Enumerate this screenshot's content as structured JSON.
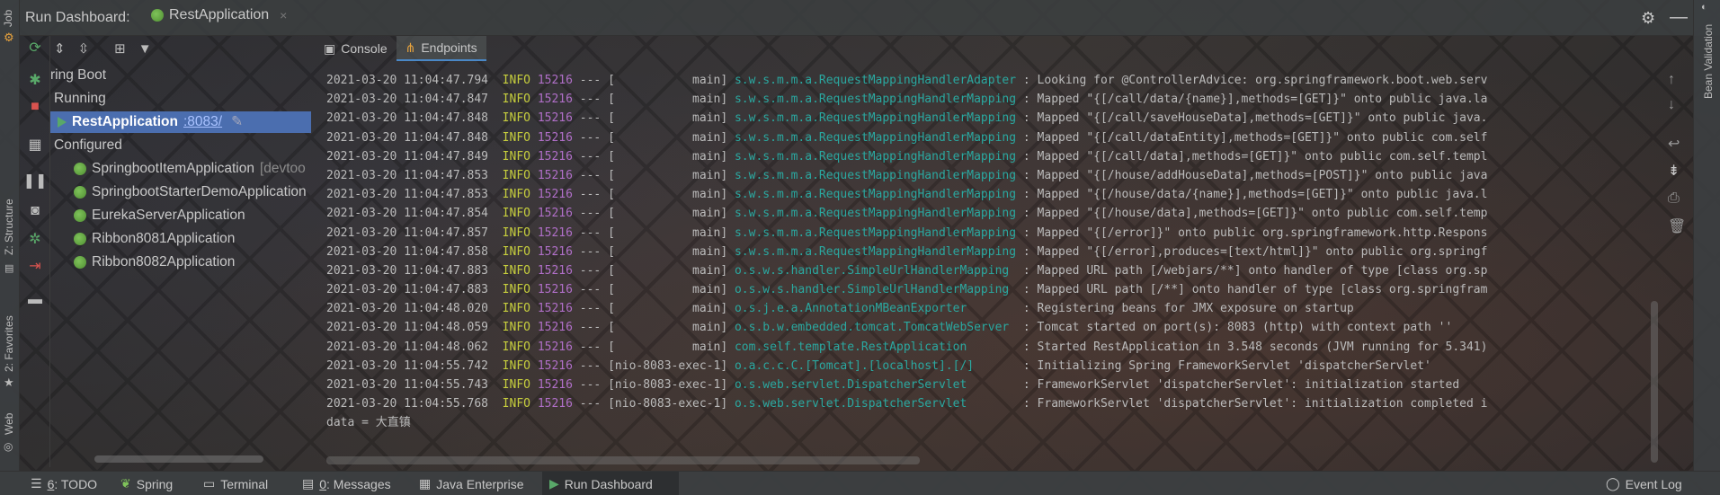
{
  "header": {
    "title": "Run Dashboard:",
    "app_tab": "RestApplication",
    "close": "×"
  },
  "left_strip": {
    "job": "Job",
    "structure": "Z: Structure",
    "favorites": "2: Favorites",
    "web": "Web"
  },
  "tree": {
    "root": "ring Boot",
    "running": "Running",
    "rest_app": "RestApplication",
    "rest_port": ":8083/",
    "configured": "Configured",
    "items": [
      {
        "name": "SpringbootItemApplication",
        "suffix": " [devtoo"
      },
      {
        "name": "SpringbootStarterDemoApplication",
        "suffix": ""
      },
      {
        "name": "EurekaServerApplication",
        "suffix": ""
      },
      {
        "name": "Ribbon8081Application",
        "suffix": ""
      },
      {
        "name": "Ribbon8082Application",
        "suffix": ""
      }
    ]
  },
  "console_tabs": {
    "console": "Console",
    "endpoints": "Endpoints"
  },
  "log": {
    "lines": [
      {
        "ts": "2021-03-20 11:04:47.794",
        "lvl": "INFO",
        "pid": "15216",
        "sep": " --- [",
        "thr": "           main]",
        "logger": "s.w.s.m.m.a.RequestMappingHandlerAdapter",
        "msg": " : Looking for @ControllerAdvice: org.springframework.boot.web.serv"
      },
      {
        "ts": "2021-03-20 11:04:47.847",
        "lvl": "INFO",
        "pid": "15216",
        "sep": " --- [",
        "thr": "           main]",
        "logger": "s.w.s.m.m.a.RequestMappingHandlerMapping",
        "msg": " : Mapped \"{[/call/data/{name}],methods=[GET]}\" onto public java.la"
      },
      {
        "ts": "2021-03-20 11:04:47.848",
        "lvl": "INFO",
        "pid": "15216",
        "sep": " --- [",
        "thr": "           main]",
        "logger": "s.w.s.m.m.a.RequestMappingHandlerMapping",
        "msg": " : Mapped \"{[/call/saveHouseData],methods=[GET]}\" onto public java."
      },
      {
        "ts": "2021-03-20 11:04:47.848",
        "lvl": "INFO",
        "pid": "15216",
        "sep": " --- [",
        "thr": "           main]",
        "logger": "s.w.s.m.m.a.RequestMappingHandlerMapping",
        "msg": " : Mapped \"{[/call/dataEntity],methods=[GET]}\" onto public com.self"
      },
      {
        "ts": "2021-03-20 11:04:47.849",
        "lvl": "INFO",
        "pid": "15216",
        "sep": " --- [",
        "thr": "           main]",
        "logger": "s.w.s.m.m.a.RequestMappingHandlerMapping",
        "msg": " : Mapped \"{[/call/data],methods=[GET]}\" onto public com.self.templ"
      },
      {
        "ts": "2021-03-20 11:04:47.853",
        "lvl": "INFO",
        "pid": "15216",
        "sep": " --- [",
        "thr": "           main]",
        "logger": "s.w.s.m.m.a.RequestMappingHandlerMapping",
        "msg": " : Mapped \"{[/house/addHouseData],methods=[POST]}\" onto public java"
      },
      {
        "ts": "2021-03-20 11:04:47.853",
        "lvl": "INFO",
        "pid": "15216",
        "sep": " --- [",
        "thr": "           main]",
        "logger": "s.w.s.m.m.a.RequestMappingHandlerMapping",
        "msg": " : Mapped \"{[/house/data/{name}],methods=[GET]}\" onto public java.l"
      },
      {
        "ts": "2021-03-20 11:04:47.854",
        "lvl": "INFO",
        "pid": "15216",
        "sep": " --- [",
        "thr": "           main]",
        "logger": "s.w.s.m.m.a.RequestMappingHandlerMapping",
        "msg": " : Mapped \"{[/house/data],methods=[GET]}\" onto public com.self.temp"
      },
      {
        "ts": "2021-03-20 11:04:47.857",
        "lvl": "INFO",
        "pid": "15216",
        "sep": " --- [",
        "thr": "           main]",
        "logger": "s.w.s.m.m.a.RequestMappingHandlerMapping",
        "msg": " : Mapped \"{[/error]}\" onto public org.springframework.http.Respons"
      },
      {
        "ts": "2021-03-20 11:04:47.858",
        "lvl": "INFO",
        "pid": "15216",
        "sep": " --- [",
        "thr": "           main]",
        "logger": "s.w.s.m.m.a.RequestMappingHandlerMapping",
        "msg": " : Mapped \"{[/error],produces=[text/html]}\" onto public org.springf"
      },
      {
        "ts": "2021-03-20 11:04:47.883",
        "lvl": "INFO",
        "pid": "15216",
        "sep": " --- [",
        "thr": "           main]",
        "logger": "o.s.w.s.handler.SimpleUrlHandlerMapping ",
        "msg": " : Mapped URL path [/webjars/**] onto handler of type [class org.sp"
      },
      {
        "ts": "2021-03-20 11:04:47.883",
        "lvl": "INFO",
        "pid": "15216",
        "sep": " --- [",
        "thr": "           main]",
        "logger": "o.s.w.s.handler.SimpleUrlHandlerMapping ",
        "msg": " : Mapped URL path [/**] onto handler of type [class org.springfram"
      },
      {
        "ts": "2021-03-20 11:04:48.020",
        "lvl": "INFO",
        "pid": "15216",
        "sep": " --- [",
        "thr": "           main]",
        "logger": "o.s.j.e.a.AnnotationMBeanExporter       ",
        "msg": " : Registering beans for JMX exposure on startup"
      },
      {
        "ts": "2021-03-20 11:04:48.059",
        "lvl": "INFO",
        "pid": "15216",
        "sep": " --- [",
        "thr": "           main]",
        "logger": "o.s.b.w.embedded.tomcat.TomcatWebServer ",
        "msg": " : Tomcat started on port(s): 8083 (http) with context path ''"
      },
      {
        "ts": "2021-03-20 11:04:48.062",
        "lvl": "INFO",
        "pid": "15216",
        "sep": " --- [",
        "thr": "           main]",
        "logger": "com.self.template.RestApplication       ",
        "msg": " : Started RestApplication in 3.548 seconds (JVM running for 5.341)"
      },
      {
        "ts": "2021-03-20 11:04:55.742",
        "lvl": "INFO",
        "pid": "15216",
        "sep": " --- [",
        "thr": "nio-8083-exec-1]",
        "logger": "o.a.c.c.C.[Tomcat].[localhost].[/]      ",
        "msg": " : Initializing Spring FrameworkServlet 'dispatcherServlet'"
      },
      {
        "ts": "2021-03-20 11:04:55.743",
        "lvl": "INFO",
        "pid": "15216",
        "sep": " --- [",
        "thr": "nio-8083-exec-1]",
        "logger": "o.s.web.servlet.DispatcherServlet       ",
        "msg": " : FrameworkServlet 'dispatcherServlet': initialization started"
      },
      {
        "ts": "2021-03-20 11:04:55.768",
        "lvl": "INFO",
        "pid": "15216",
        "sep": " --- [",
        "thr": "nio-8083-exec-1]",
        "logger": "o.s.web.servlet.DispatcherServlet       ",
        "msg": " : FrameworkServlet 'dispatcherServlet': initialization completed i"
      }
    ],
    "output": "data = 大直镇"
  },
  "right_strip": {
    "bean_validation": "Bean Validation"
  },
  "bottom": {
    "todo_num": "6",
    "todo": ": TODO",
    "spring": "Spring",
    "terminal": "Terminal",
    "messages_num": "0",
    "messages": ": Messages",
    "java_ee": "Java Enterprise",
    "run_dashboard": "Run Dashboard",
    "event_log": "Event Log"
  },
  "colors": {
    "selection": "#4b6eaf",
    "info": "#c6ce3d",
    "pid": "#b06fc8",
    "logger": "#2aa8a0",
    "run_green": "#59a869"
  }
}
